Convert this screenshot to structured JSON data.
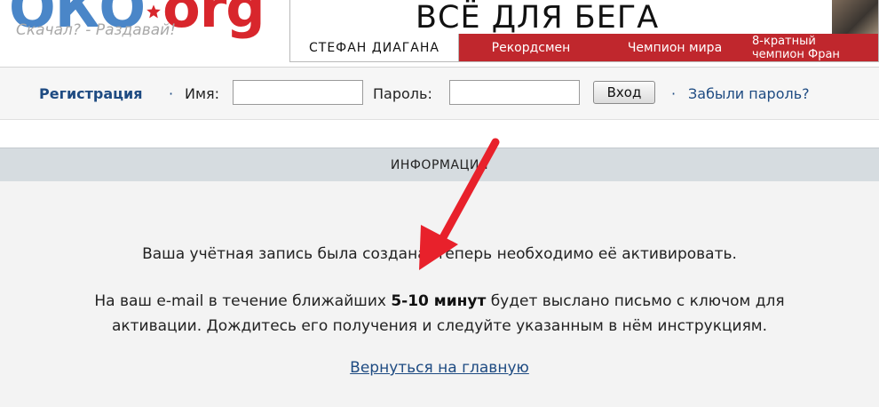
{
  "site": {
    "logo_part1": "ОКО",
    "logo_part2": "org",
    "slogan": "Скачал? - Раздавай!"
  },
  "banner": {
    "title": "ВСЁ ДЛЯ БЕГА",
    "captions": [
      "СТЕФАН ДИАГАНА",
      "Рекордсмен",
      "Чемпион мира"
    ],
    "last_caption_line1": "8-кратный",
    "last_caption_line2": "чемпион Фран"
  },
  "login": {
    "register_label": "Регистрация",
    "separator": "·",
    "name_label": "Имя:",
    "name_value": "",
    "password_label": "Пароль:",
    "password_value": "",
    "submit_label": "Вход",
    "forgot_label": "Забыли пароль?"
  },
  "section": {
    "title": "ИНФОРМАЦИЯ"
  },
  "message": {
    "line1": "Ваша учётная запись была создана, теперь необходимо её активировать.",
    "line2_before": "На ваш e-mail в течение ближайших ",
    "line2_bold": "5-10 минут",
    "line2_after": " будет выслано письмо с ключом для",
    "line3": "активации. Дождитесь его получения и следуйте указанным в нём инструкциям.",
    "back_link": "Вернуться на главную"
  },
  "colors": {
    "link": "#1e4b82",
    "banner_red": "#c0272d",
    "section_bg": "#d6dce0",
    "arrow": "#e8212b"
  }
}
